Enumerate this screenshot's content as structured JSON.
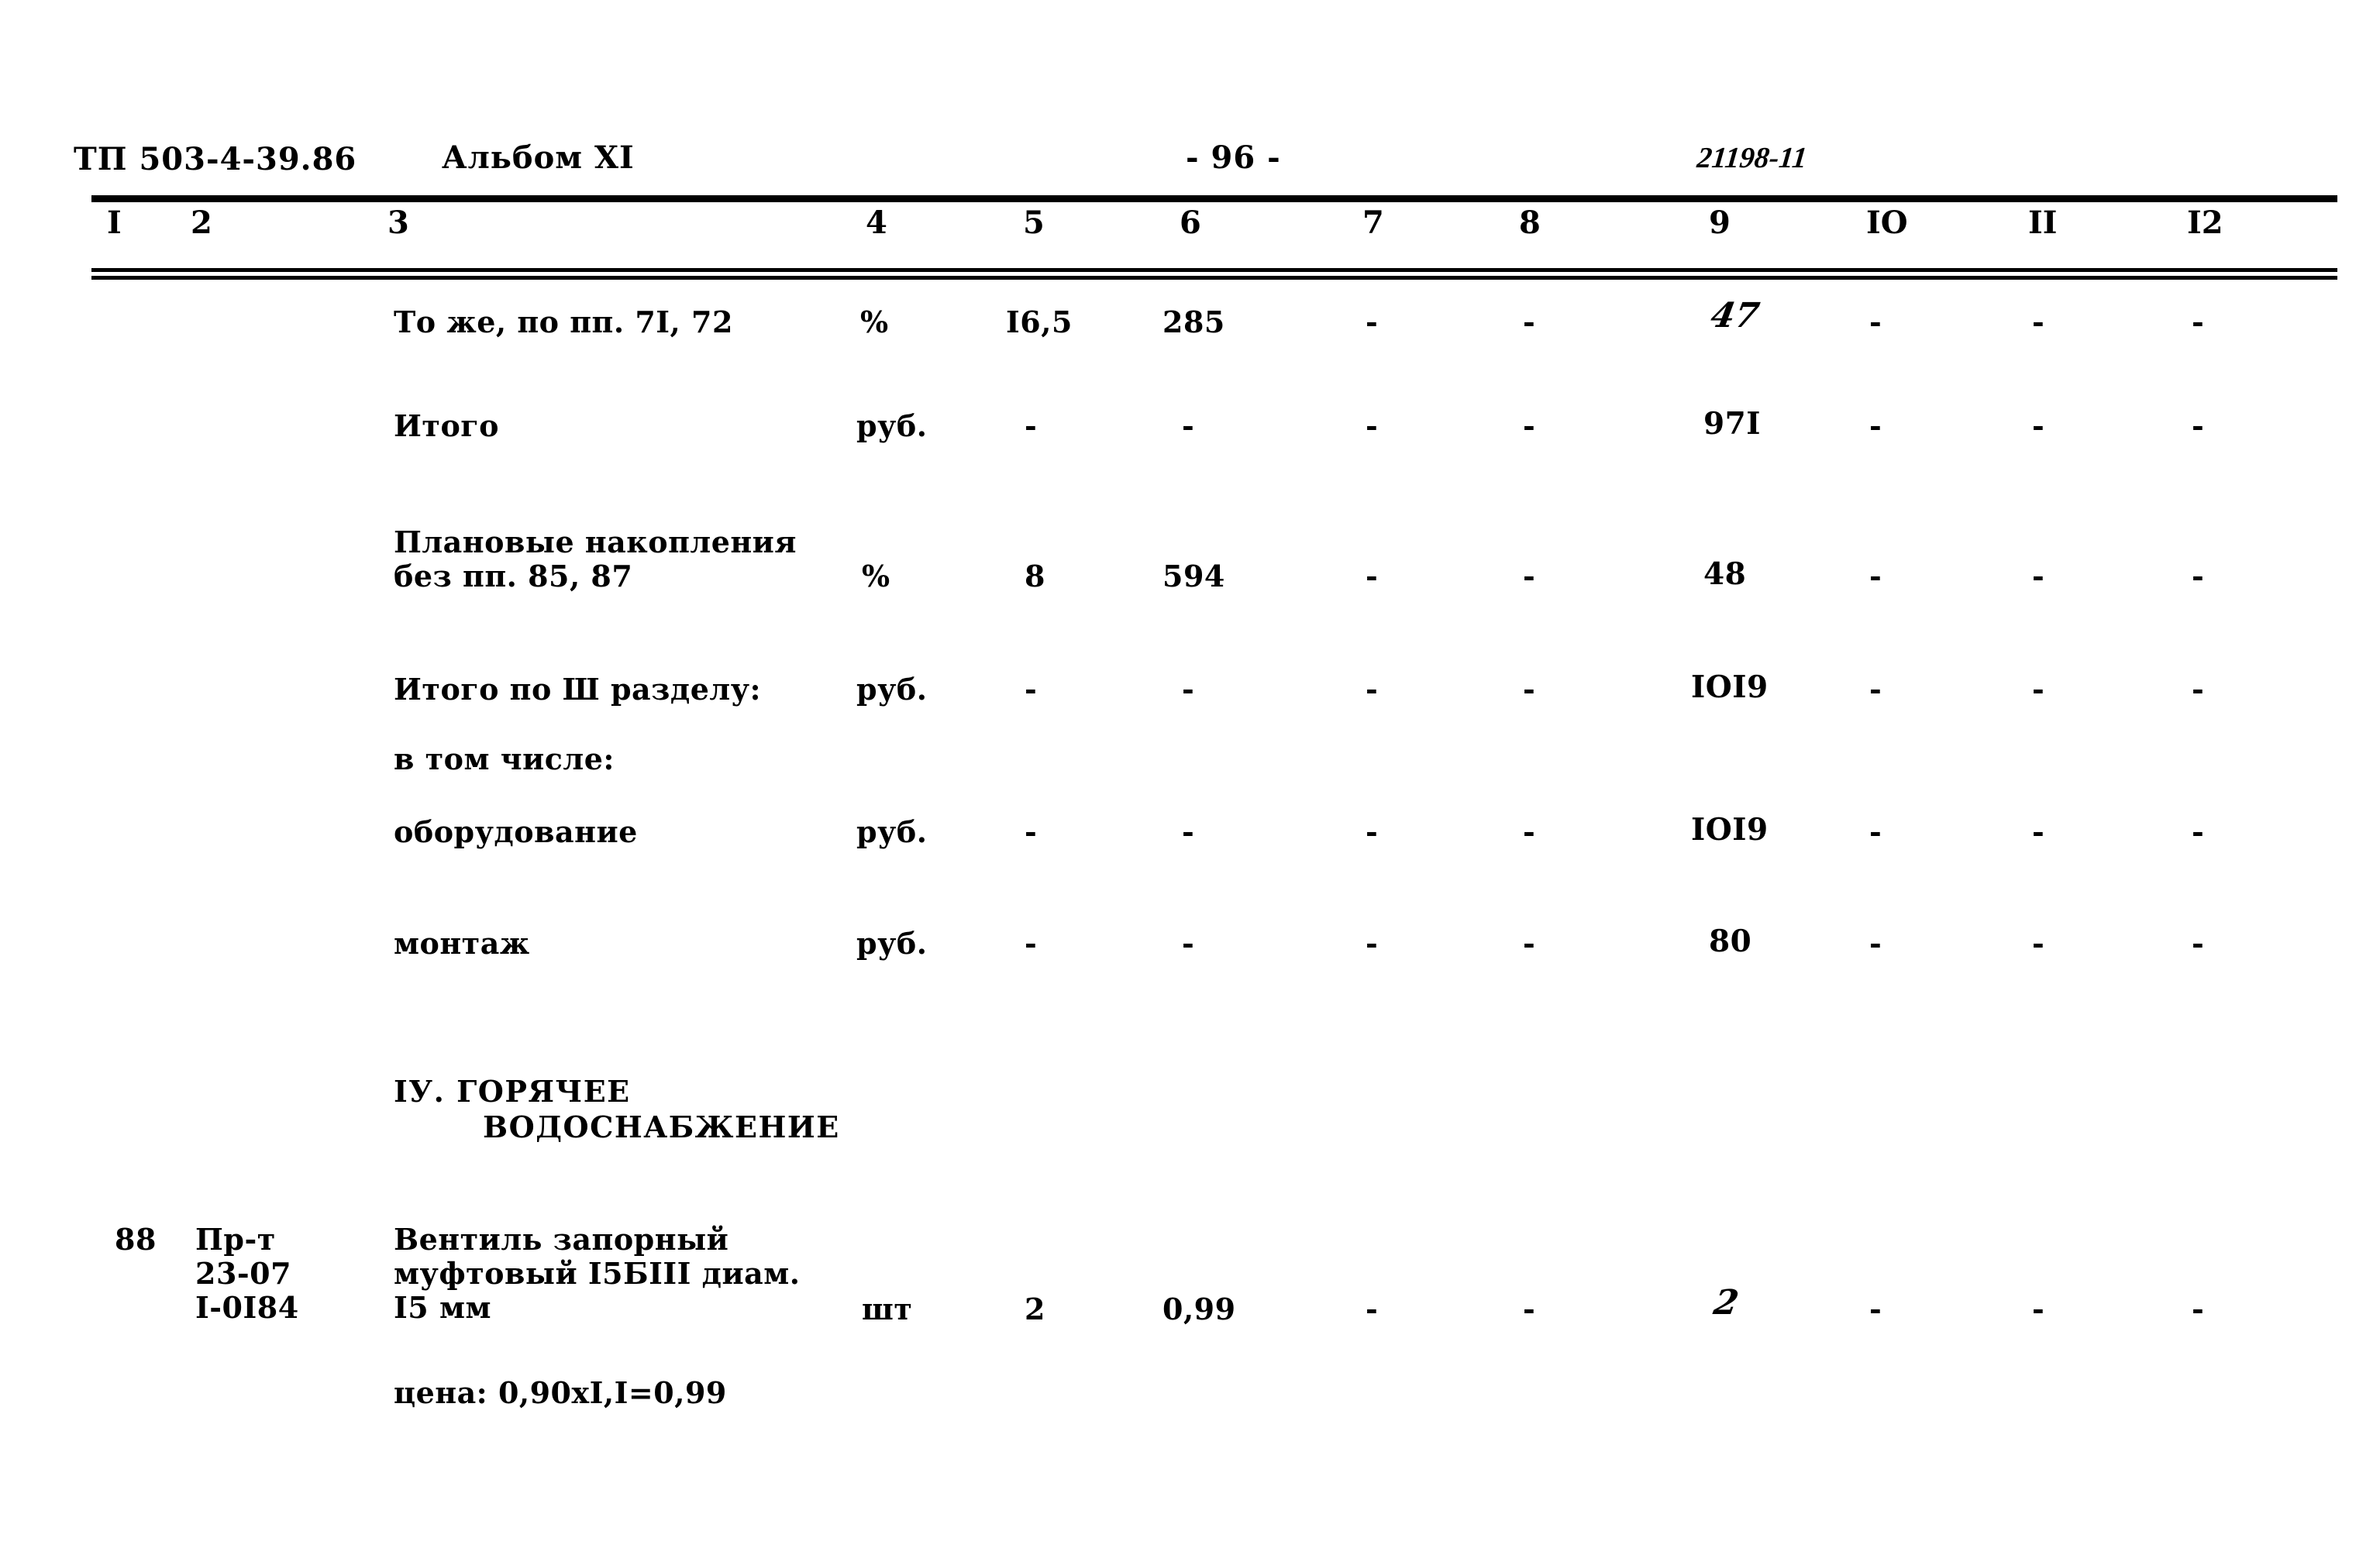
{
  "header": {
    "doc_code": "ТП 503-4-39.86",
    "album": "Альбом XI",
    "page_number": "- 96 -",
    "sheet_number": "21198-11"
  },
  "table": {
    "column_numbers": [
      "I",
      "2",
      "3",
      "4",
      "5",
      "6",
      "7",
      "8",
      "9",
      "IO",
      "II",
      "I2"
    ],
    "rows": [
      {
        "c1": "",
        "c2": "",
        "c3_line1": "То же, по пп. 7I, 72",
        "c3_line2": "",
        "c3_line3": "",
        "c4": "%",
        "c5": "I6,5",
        "c6": "285",
        "c7": "-",
        "c8": "-",
        "c9": "47",
        "c9_hand": true,
        "c10": "-",
        "c11": "-",
        "c12": "-"
      },
      {
        "c1": "",
        "c2": "",
        "c3_line1": "Итого",
        "c3_line2": "",
        "c3_line3": "",
        "c4": "руб.",
        "c5": "-",
        "c6": "-",
        "c7": "-",
        "c8": "-",
        "c9": "97I",
        "c9_hand": false,
        "c10": "-",
        "c11": "-",
        "c12": "-"
      },
      {
        "c1": "",
        "c2": "",
        "c3_line1": "Плановые накопления",
        "c3_line2": "без пп. 85, 87",
        "c3_line3": "",
        "c4": "%",
        "c5": "8",
        "c6": "594",
        "c7": "-",
        "c8": "-",
        "c9": "48",
        "c9_hand": false,
        "c10": "-",
        "c11": "-",
        "c12": "-"
      },
      {
        "c1": "",
        "c2": "",
        "c3_line1": "Итого по Ш разделу:",
        "c3_line2": "",
        "c3_line3": "",
        "c4": "руб.",
        "c5": "-",
        "c6": "-",
        "c7": "-",
        "c8": "-",
        "c9": "IOI9",
        "c9_hand": false,
        "c10": "-",
        "c11": "-",
        "c12": "-"
      },
      {
        "c1": "",
        "c2": "",
        "c3_line1": "в том числе:",
        "c3_line2": "",
        "c3_line3": "",
        "c4": "",
        "c5": "",
        "c6": "",
        "c7": "",
        "c8": "",
        "c9": "",
        "c9_hand": false,
        "c10": "",
        "c11": "",
        "c12": ""
      },
      {
        "c1": "",
        "c2": "",
        "c3_line1": "оборудование",
        "c3_line2": "",
        "c3_line3": "",
        "c4": "руб.",
        "c5": "-",
        "c6": "-",
        "c7": "-",
        "c8": "-",
        "c9": "IOI9",
        "c9_hand": false,
        "c10": "-",
        "c11": "-",
        "c12": "-"
      },
      {
        "c1": "",
        "c2": "",
        "c3_line1": "монтаж",
        "c3_line2": "",
        "c3_line3": "",
        "c4": "руб.",
        "c5": "-",
        "c6": "-",
        "c7": "-",
        "c8": "-",
        "c9": "80",
        "c9_hand": false,
        "c10": "-",
        "c11": "-",
        "c12": "-"
      },
      {
        "c1": "88",
        "c2_line1": "Пр-т",
        "c2_line2": "23-07",
        "c2_line3": "I-0I84",
        "c3_line1": "Вентиль запорный",
        "c3_line2": "муфтовый I5БIII диам.",
        "c3_line3": "I5 мм",
        "c4": "шт",
        "c5": "2",
        "c6": "0,99",
        "c7": "-",
        "c8": "-",
        "c9": "2",
        "c9_hand": true,
        "c10": "-",
        "c11": "-",
        "c12": "-"
      }
    ],
    "section_heading": {
      "line1": "IУ. ГОРЯЧЕЕ",
      "line2": "ВОДОСНАБЖЕНИЕ"
    },
    "price_note": "цена: 0,90хI,I=0,99"
  }
}
